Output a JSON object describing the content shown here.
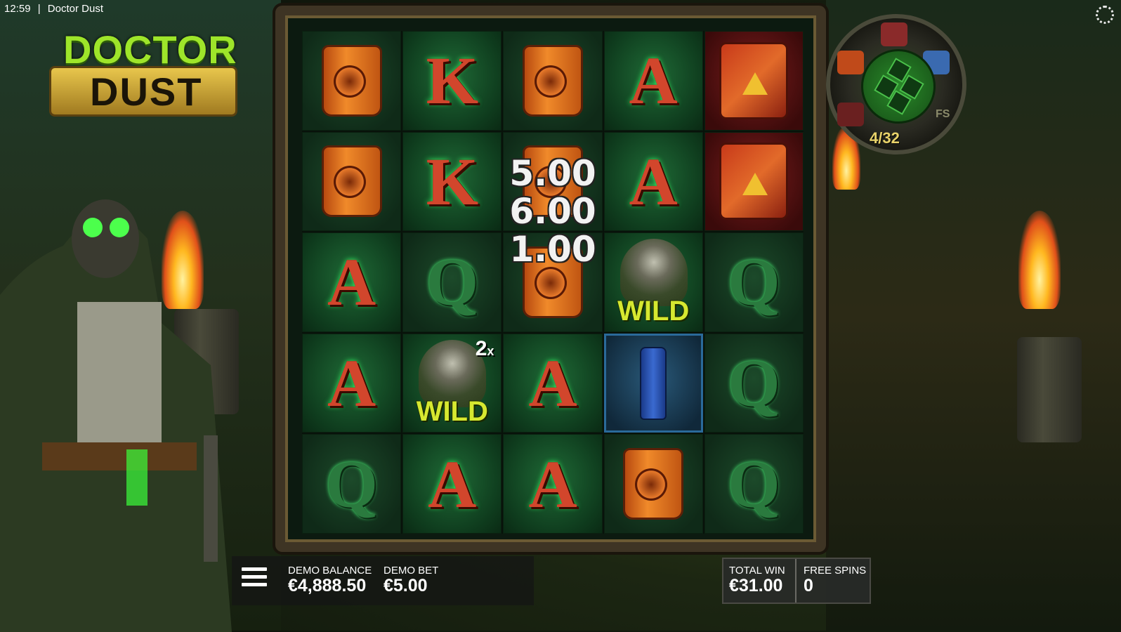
{
  "status_bar": {
    "time": "12:59",
    "separator": "|",
    "title": "Doctor Dust"
  },
  "logo": {
    "line1": "DOCTOR",
    "line2": "DUST"
  },
  "grid": [
    [
      {
        "type": "can"
      },
      {
        "type": "letter",
        "label": "K",
        "color": "red"
      },
      {
        "type": "can"
      },
      {
        "type": "letter",
        "label": "A",
        "color": "red"
      },
      {
        "type": "jerry"
      }
    ],
    [
      {
        "type": "can"
      },
      {
        "type": "letter",
        "label": "K",
        "color": "red"
      },
      {
        "type": "can"
      },
      {
        "type": "letter",
        "label": "A",
        "color": "red"
      },
      {
        "type": "jerry"
      }
    ],
    [
      {
        "type": "letter",
        "label": "A",
        "color": "red"
      },
      {
        "type": "letter",
        "label": "Q",
        "color": "green"
      },
      {
        "type": "can"
      },
      {
        "type": "wild",
        "label": "WILD"
      },
      {
        "type": "letter",
        "label": "Q",
        "color": "green"
      }
    ],
    [
      {
        "type": "letter",
        "label": "A",
        "color": "red"
      },
      {
        "type": "wild",
        "label": "WILD",
        "multiplier": "2",
        "mult_sign": "x"
      },
      {
        "type": "letter",
        "label": "A",
        "color": "red"
      },
      {
        "type": "bottle"
      },
      {
        "type": "letter",
        "label": "Q",
        "color": "green"
      }
    ],
    [
      {
        "type": "letter",
        "label": "Q",
        "color": "green"
      },
      {
        "type": "letter",
        "label": "A",
        "color": "red"
      },
      {
        "type": "letter",
        "label": "A",
        "color": "red"
      },
      {
        "type": "can"
      },
      {
        "type": "letter",
        "label": "Q",
        "color": "green"
      }
    ]
  ],
  "win_values": [
    "5.00",
    "6.00",
    "1.00"
  ],
  "meter": {
    "progress": "4/32",
    "fs_label": "FS"
  },
  "footer": {
    "balance_label": "DEMO BALANCE",
    "balance_value": "€4,888.50",
    "bet_label": "DEMO BET",
    "bet_value": "€5.00",
    "total_win_label": "TOTAL WIN",
    "total_win_value": "€31.00",
    "free_spins_label": "FREE SPINS",
    "free_spins_value": "0"
  },
  "colors": {
    "accent_green": "#9ee52a",
    "wild_yellow": "#d6e830",
    "letter_red": "#d2462c",
    "letter_green": "#2a7a3e"
  }
}
